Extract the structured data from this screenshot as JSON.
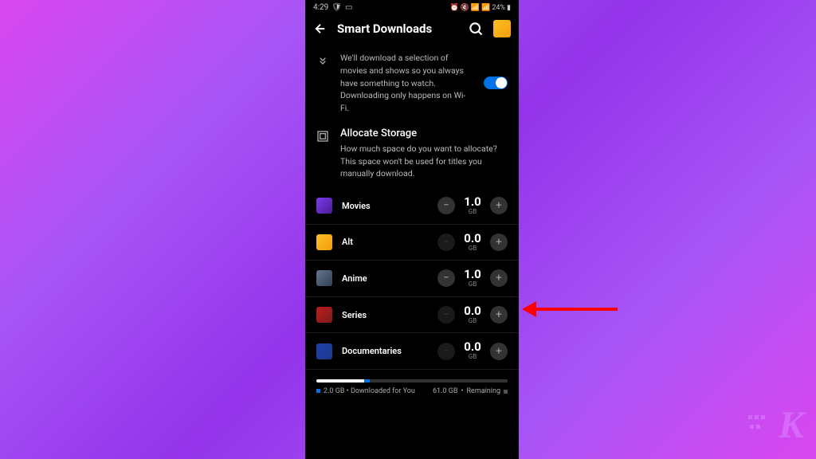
{
  "status": {
    "time": "4:29",
    "battery": "24%"
  },
  "header": {
    "title": "Smart Downloads"
  },
  "smartDownloads": {
    "description": "We'll download a selection of movies and shows so you always have something to watch. Downloading only happens on Wi-Fi.",
    "enabled": true
  },
  "allocate": {
    "title": "Allocate Storage",
    "description": "How much space do you want to allocate? This space won't be used for titles you manually download."
  },
  "categories": [
    {
      "name": "Movies",
      "value": "1.0",
      "unit": "GB",
      "canDecrease": true
    },
    {
      "name": "Alt",
      "value": "0.0",
      "unit": "GB",
      "canDecrease": false
    },
    {
      "name": "Anime",
      "value": "1.0",
      "unit": "GB",
      "canDecrease": true
    },
    {
      "name": "Series",
      "value": "0.0",
      "unit": "GB",
      "canDecrease": false
    },
    {
      "name": "Documentaries",
      "value": "0.0",
      "unit": "GB",
      "canDecrease": false
    }
  ],
  "storage": {
    "downloaded": "2.0 GB",
    "downloadedLabel": "Downloaded for You",
    "remaining": "61.0 GB",
    "remainingLabel": "Remaining"
  }
}
